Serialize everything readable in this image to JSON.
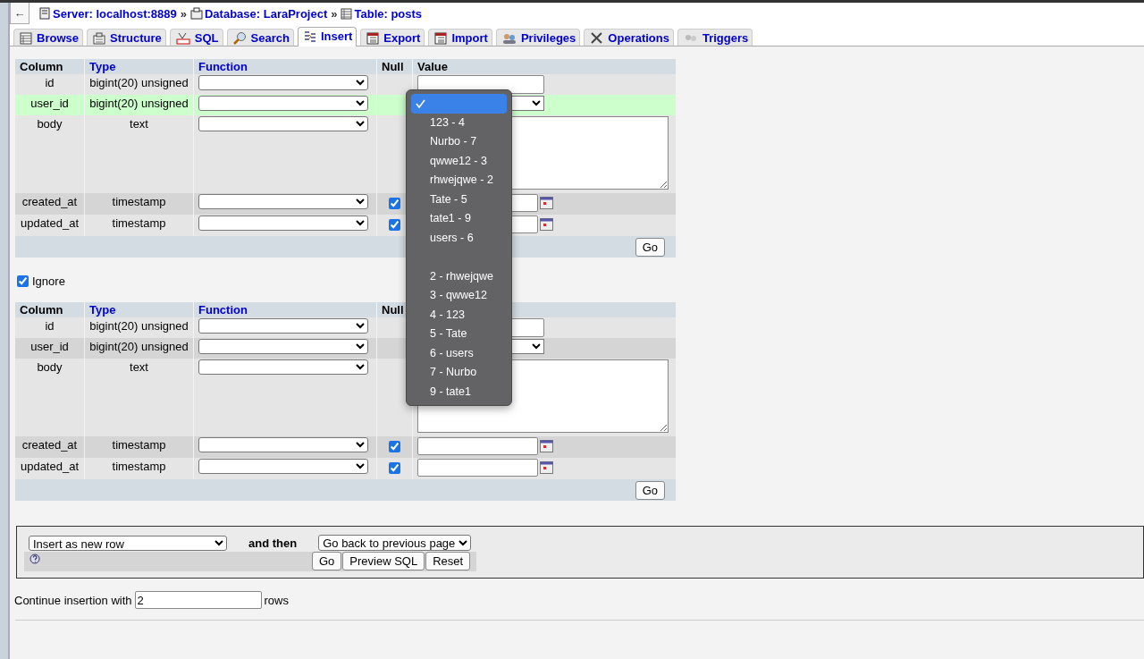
{
  "back_button": {
    "label": "←"
  },
  "breadcrumb": [
    {
      "kind": "server",
      "label": "Server: localhost:8889"
    },
    {
      "kind": "database",
      "label": "Database: LaraProject"
    },
    {
      "kind": "table",
      "label": "Table: posts"
    }
  ],
  "breadcrumb_separator": "»",
  "tabs": [
    {
      "kind": "browse",
      "label": "Browse",
      "selected": false
    },
    {
      "kind": "structure",
      "label": "Structure",
      "selected": false
    },
    {
      "kind": "sql",
      "label": "SQL",
      "selected": false
    },
    {
      "kind": "search",
      "label": "Search",
      "selected": false
    },
    {
      "kind": "insert",
      "label": "Insert",
      "selected": true
    },
    {
      "kind": "export",
      "label": "Export",
      "selected": false
    },
    {
      "kind": "import",
      "label": "Import",
      "selected": false
    },
    {
      "kind": "privileges",
      "label": "Privileges",
      "selected": false
    },
    {
      "kind": "operations",
      "label": "Operations",
      "selected": false
    },
    {
      "kind": "triggers",
      "label": "Triggers",
      "selected": false
    }
  ],
  "insert_forms": [
    {
      "columns": [
        {
          "label": "Column",
          "link": false
        },
        {
          "label": "Type",
          "link": true
        },
        {
          "label": "Function",
          "link": true
        },
        {
          "label": "Null",
          "link": false
        },
        {
          "label": "Value",
          "link": false
        }
      ],
      "rows": [
        {
          "column": "id",
          "type": "bigint(20) unsigned",
          "highlighted": false,
          "kind": "input"
        },
        {
          "column": "user_id",
          "type": "bigint(20) unsigned",
          "highlighted": true,
          "kind": "select"
        },
        {
          "column": "body",
          "type": "text",
          "highlighted": false,
          "kind": "textarea"
        },
        {
          "column": "created_at",
          "type": "timestamp",
          "highlighted": false,
          "null_checked": true,
          "kind": "datetime"
        },
        {
          "column": "updated_at",
          "type": "timestamp",
          "highlighted": false,
          "null_checked": true,
          "kind": "datetime"
        }
      ],
      "go_button": "Go"
    },
    {
      "columns": [
        {
          "label": "Column",
          "link": false
        },
        {
          "label": "Type",
          "link": true
        },
        {
          "label": "Function",
          "link": true
        },
        {
          "label": "Null",
          "link": false
        }
      ],
      "rows": [
        {
          "column": "id",
          "type": "bigint(20) unsigned",
          "highlighted": false,
          "kind": "input"
        },
        {
          "column": "user_id",
          "type": "bigint(20) unsigned",
          "highlighted": false,
          "kind": "select"
        },
        {
          "column": "body",
          "type": "text",
          "highlighted": false,
          "kind": "textarea"
        },
        {
          "column": "created_at",
          "type": "timestamp",
          "highlighted": false,
          "null_checked": true,
          "kind": "datetime"
        },
        {
          "column": "updated_at",
          "type": "timestamp",
          "highlighted": false,
          "null_checked": true,
          "kind": "datetime"
        }
      ],
      "go_button": "Go"
    }
  ],
  "ignore": {
    "label": "Ignore",
    "checked": true
  },
  "dropdown": {
    "blank_selected": true,
    "groups": [
      [
        {
          "label": "123 - 4",
          "selected": false
        },
        {
          "label": "Nurbo - 7",
          "selected": false
        },
        {
          "label": "qwwe12 - 3",
          "selected": false
        },
        {
          "label": "rhwejqwe - 2",
          "selected": false
        },
        {
          "label": "Tate - 5",
          "selected": false
        },
        {
          "label": "tate1 - 9",
          "selected": false
        },
        {
          "label": "users - 6",
          "selected": false
        }
      ],
      [
        {
          "label": "2 - rhwejqwe",
          "selected": false
        },
        {
          "label": "3 - qwwe12",
          "selected": false
        },
        {
          "label": "4 - 123",
          "selected": false
        },
        {
          "label": "5 - Tate",
          "selected": false
        },
        {
          "label": "6 - users",
          "selected": false
        },
        {
          "label": "7 - Nurbo",
          "selected": false
        },
        {
          "label": "9 - tate1",
          "selected": false
        }
      ]
    ]
  },
  "actions": {
    "insert_mode": "Insert as new row",
    "and_then": "and then",
    "after_action": "Go back to previous page",
    "buttons": [
      "Go",
      "Preview SQL",
      "Reset"
    ]
  },
  "continue": {
    "label": "Continue insertion with",
    "value": "2",
    "suffix": "rows"
  }
}
